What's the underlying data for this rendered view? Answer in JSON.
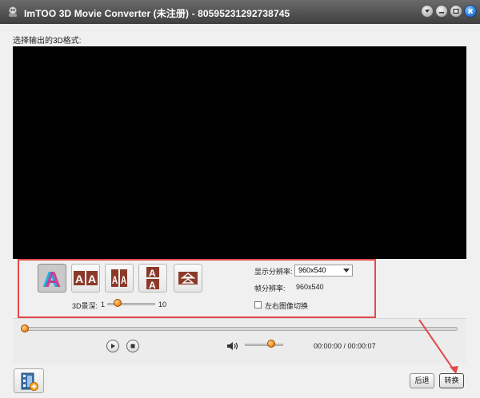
{
  "titlebar": {
    "title": "ImTOO 3D Movie Converter (未注册) - 80595231292738745",
    "icons": [
      "app-icon",
      "menu-icon",
      "minimize-icon",
      "restore-icon",
      "close-icon"
    ]
  },
  "main": {
    "section_label": "选择输出的3D格式:"
  },
  "format_panel": {
    "options": [
      {
        "name": "anaglyph",
        "selected": true
      },
      {
        "name": "side-by-side"
      },
      {
        "name": "side-by-side-half"
      },
      {
        "name": "top-bottom"
      },
      {
        "name": "top-bottom-half"
      }
    ],
    "depth": {
      "label": "3D景深:",
      "min": "1",
      "max": "10",
      "value": 2
    },
    "display_resolution": {
      "label": "显示分辨率:",
      "value": "960x540"
    },
    "frame_resolution": {
      "label": "帧分辨率:",
      "value": "960x540"
    },
    "swap_lr": {
      "label": "左右图像切换",
      "checked": false
    }
  },
  "player": {
    "time": "00:00:00 / 00:00:07",
    "progress": 0,
    "volume": 0.65,
    "icons": [
      "play-icon",
      "stop-icon",
      "volume-icon"
    ]
  },
  "footer": {
    "back_label": "后退",
    "convert_label": "转换"
  },
  "colors": {
    "highlight_border": "#e24a4a",
    "slider_thumb": "#f08a1e"
  }
}
